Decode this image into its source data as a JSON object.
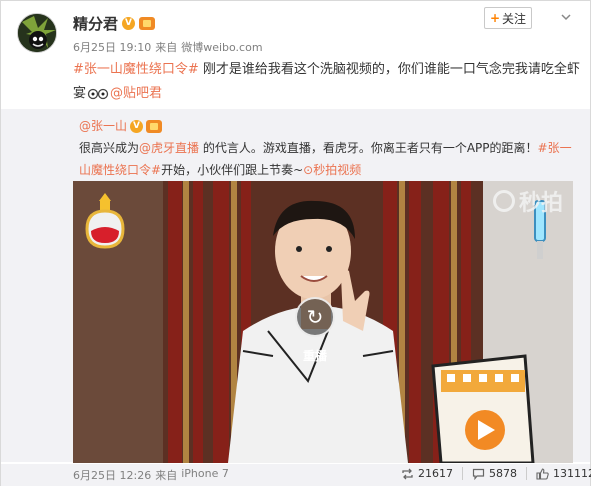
{
  "post": {
    "author": "精分君",
    "date": "6月25日 19:10",
    "source_prefix": "来自",
    "source": "微博weibo.com",
    "follow_label": "关注",
    "text": {
      "tag": "#张一山魔性绕口令#",
      "body": " 刚才是谁给我看这个洗脑视频的，你们谁能一口气念完我请吃全虾宴",
      "mention": "@贴吧君"
    }
  },
  "repost": {
    "author": "@张一山",
    "text_1": "很高兴成为",
    "mention": "@虎牙直播",
    "text_2": " 的代言人。游戏直播，看虎牙。你离王者只有一个APP的距离！",
    "tag": "#张一山魔性绕口令#",
    "text_3": "开始，小伙伴们跟上节奏~",
    "video_link": "秒拍视频",
    "video": {
      "watermark": "秒拍",
      "replay_label": "重播"
    },
    "date": "6月25日 12:26",
    "source_prefix": "来自",
    "source": "iPhone 7",
    "stats": {
      "reposts": "21617",
      "comments": "5878",
      "likes": "131112"
    }
  },
  "icons": {
    "verified": "v-badge",
    "vip": "vip-badge",
    "emoji": "glasses-emoji",
    "repost": "repost-icon",
    "comment": "comment-icon",
    "like": "thumbs-up-icon",
    "replay": "replay-icon",
    "menu": "chevron-down-icon"
  },
  "colors": {
    "link": "#eb7350",
    "accent": "#ff8200",
    "repost_bg": "#f2f2f5"
  }
}
